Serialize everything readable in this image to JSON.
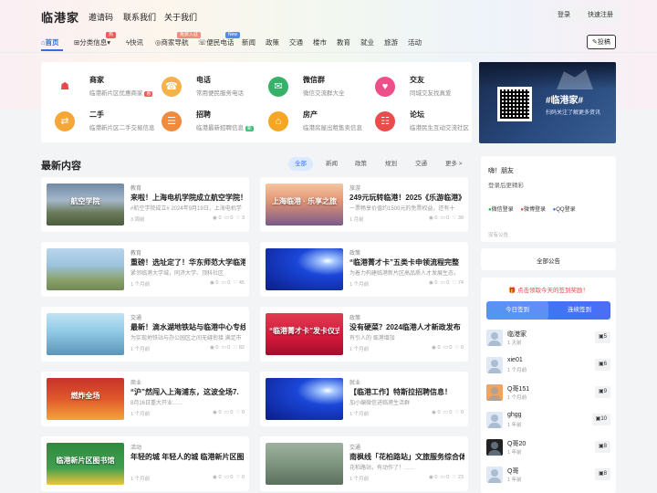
{
  "site": {
    "logo": "临港家"
  },
  "toplinks": [
    "邀请码",
    "联系我们",
    "关于我们"
  ],
  "auth": {
    "login": "登录",
    "register": "快速注册"
  },
  "nav": {
    "items": [
      {
        "icon": "⌂",
        "label": "首页"
      },
      {
        "icon": "⊞",
        "label": "分类信息",
        "arrow": "▾",
        "tag": "热"
      },
      {
        "icon": "ϟ",
        "label": "快讯"
      },
      {
        "icon": "◎",
        "label": "商家导航",
        "tag": "免费入驻"
      },
      {
        "icon": "☏",
        "label": "便民电话",
        "tag": "New"
      },
      {
        "label": "新闻"
      },
      {
        "label": "政策"
      },
      {
        "label": "交通"
      },
      {
        "label": "楼市"
      },
      {
        "label": "教育"
      },
      {
        "label": "就业"
      },
      {
        "label": "旅游"
      },
      {
        "label": "活动"
      }
    ],
    "post_button": "投稿",
    "post_icon": "✎"
  },
  "categories": [
    {
      "icon": "☗",
      "title": "商家",
      "sub": "临港新片区优惠商家",
      "badge": "惠",
      "color": "#e5484d",
      "bg": "#fff"
    },
    {
      "icon": "☎",
      "title": "电话",
      "sub": "常用便民服务电话",
      "color": "#fff",
      "bg": "#f5b14c"
    },
    {
      "icon": "✉",
      "title": "微信群",
      "sub": "微信交流群大全",
      "color": "#fff",
      "bg": "#35b16a"
    },
    {
      "icon": "♥",
      "title": "交友",
      "sub": "同城交友找真爱",
      "color": "#fff",
      "bg": "#ee4f8a"
    },
    {
      "icon": "⇄",
      "title": "二手",
      "sub": "临港新片区二手交易信息",
      "color": "#fff",
      "bg": "#f5a637"
    },
    {
      "icon": "☰",
      "title": "招聘",
      "sub": "临港最新招聘信息",
      "badge": "新",
      "color": "#fff",
      "bg": "#f08a3c"
    },
    {
      "icon": "⌂",
      "title": "房产",
      "sub": "临港房屋出租售卖信息",
      "color": "#fff",
      "bg": "#f5a623"
    },
    {
      "icon": "☷",
      "title": "论坛",
      "sub": "临港民生互动交流社区",
      "color": "#fff",
      "bg": "#ea4c4c"
    }
  ],
  "banner": {
    "title": "#临港家#",
    "sub": "扫码关注了解更多资讯"
  },
  "content": {
    "section_title": "最新内容",
    "tabs": [
      "全部",
      "新闻",
      "政策",
      "规划",
      "交通",
      "更多 >"
    ]
  },
  "posts": [
    {
      "category": "教育",
      "title": "来啦！上海电机学院成立航空学院！",
      "excerpt": "#航空学院成立# 2024年9月19日，上海电机学",
      "time": "3 周前",
      "views": "0",
      "comments": "0",
      "likes": "3",
      "thumb_bg": "linear-gradient(180deg,#6f8aa6 0%,#a6b8c9 40%,#6b7a5a 70%,#4d5c3f 100%)",
      "thumb_text": "航空学院"
    },
    {
      "category": "旅游",
      "title": "249元玩转临港！2025《乐游临港》",
      "excerpt": "一票畅享价值约1500元的免票权益，还有十",
      "time": "1 月前",
      "views": "0",
      "comments": "0",
      "likes": "39",
      "thumb_bg": "linear-gradient(180deg,#f3c6a1 0%,#e59674 40%,#7a5a8a 100%)",
      "thumb_text": "上海临港 · 乐享之旅"
    },
    {
      "category": "教育",
      "title": "重磅！选址定了！华东师范大学临港",
      "excerpt": "紧邻临港大学城，同济大学、顶科社区",
      "time": "1 个月前",
      "views": "0",
      "comments": "0",
      "likes": "45",
      "thumb_bg": "linear-gradient(180deg,#b9d6ec 0%,#9cc3de 40%,#8aa16b 75%,#6f8a54 100%)",
      "thumb_text": ""
    },
    {
      "category": "政策",
      "title": "“临港菁才卡”五类卡申领流程完整",
      "excerpt": "为着力构建临港新片区高品质人才发展生态，",
      "time": "1 个月前",
      "views": "0",
      "comments": "0",
      "likes": "74",
      "thumb_bg": "radial-gradient(ellipse at 80% 30%,#ffffff 0%,#a6c8ff 8%,#1a46d8 35%,#0b1d8a 100%)",
      "thumb_text": ""
    },
    {
      "category": "交通",
      "title": "最新！滴水湖地铁站与临港中心专线",
      "excerpt": "为实现地铁站与办公园区之间无缝衔接 满足市",
      "time": "1 个月前",
      "views": "0",
      "comments": "0",
      "likes": "82",
      "thumb_bg": "linear-gradient(180deg,#bfe3f5 0%,#8fc9e6 45%,#5d95b8 100%)",
      "thumb_text": ""
    },
    {
      "category": "政策",
      "title": "没有硬菜？2024临港人才新政发布",
      "excerpt": "有引人的 临港增加",
      "time": "1 个月前",
      "views": "0",
      "comments": "0",
      "likes": "0",
      "thumb_bg": "linear-gradient(180deg,#e03b52 0%,#d1183a 60%,#a10e2d 100%)",
      "thumb_text": "“临港菁才卡”发卡仪式"
    },
    {
      "category": "商业",
      "title": "“沪”然闯入上海浦东，这波全场7.",
      "excerpt": "8月16日重大开业……",
      "time": "1 个月前",
      "views": "0",
      "comments": "0",
      "likes": "0",
      "thumb_bg": "linear-gradient(180deg,#c7322a 0%,#e0592b 50%,#f3a33b 100%)",
      "thumb_text": "燃炸全场"
    },
    {
      "category": "就业",
      "title": "【临港工作】特斯拉招聘信息！",
      "excerpt": "加小编微信进临港生活群",
      "time": "1 个月前",
      "views": "0",
      "comments": "0",
      "likes": "0",
      "thumb_bg": "radial-gradient(ellipse at 80% 30%,#ffffff 0%,#a6c8ff 8%,#1a46d8 35%,#0b1d8a 100%)",
      "thumb_text": ""
    },
    {
      "category": "活动",
      "title": "年轻的城 年轻人的城 临港新片区图",
      "excerpt": "",
      "time": "1 个月前",
      "views": "0",
      "comments": "0",
      "likes": "0",
      "thumb_bg": "linear-gradient(180deg,#2f8a3e 0%,#3ea04f 60%,#f1c43a 100%)",
      "thumb_text": "临港新片区图书馆"
    },
    {
      "category": "交通",
      "title": "南枫线「花柏路站」文旅服务综合体",
      "excerpt": "花柏路站，有动作了！……",
      "time": "1 个月前",
      "views": "0",
      "comments": "0",
      "likes": "23",
      "thumb_bg": "linear-gradient(180deg,#9fb2a0 0%,#7d957e 50%,#5c6f5e 100%)",
      "thumb_text": ""
    }
  ],
  "login_box": {
    "greeting": "嗨！朋友",
    "sub": "登录后更精彩",
    "options": [
      {
        "icon": "●",
        "label": "微信登录",
        "color": "#22b14c"
      },
      {
        "icon": "●",
        "label": "微博登录",
        "color": "#e5484d"
      },
      {
        "icon": "●",
        "label": "QQ登录",
        "color": "#2f6fe4"
      }
    ],
    "note": "没有公告"
  },
  "announce": {
    "label": "全部公告"
  },
  "checkin": {
    "hint": "点击领取今天的签到奖励！",
    "btn_today": "今日签到",
    "btn_rank": "连续签到"
  },
  "users": [
    {
      "name": "临港家",
      "sub": "1 天前",
      "count": "5",
      "av": "#dfe9f6"
    },
    {
      "name": "xie01",
      "sub": "1 个月前",
      "count": "6",
      "av": "#dfe9f6"
    },
    {
      "name": "Q哥151",
      "sub": "1 个月前",
      "count": "9",
      "av": "#f3a35a"
    },
    {
      "name": "ghgg",
      "sub": "1 年前",
      "count": "10",
      "av": "#dfe9f6"
    },
    {
      "name": "Q哥20",
      "sub": "1 年前",
      "count": "8",
      "av": "#222"
    },
    {
      "name": "Q哥",
      "sub": "1 年前",
      "count": "8",
      "av": "#dfe9f6"
    }
  ]
}
